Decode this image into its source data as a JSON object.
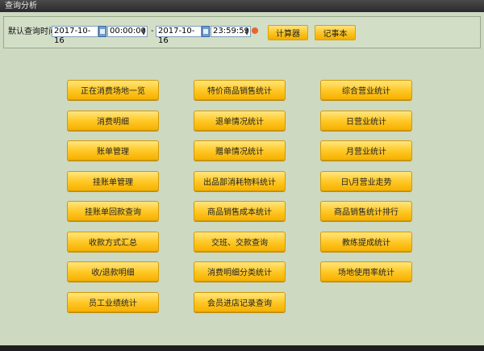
{
  "window": {
    "title": "查询分析"
  },
  "toolbar": {
    "label": "默认查询时间",
    "start_date": "2017-10-16",
    "start_time": "00:00:00",
    "separator": "-",
    "end_date": "2017-10-16",
    "end_time": "23:59:59",
    "calculator_label": "计算器",
    "notepad_label": "记事本"
  },
  "grid": [
    [
      "正在消费场地一览",
      "特价商品销售统计",
      "综合营业统计"
    ],
    [
      "消费明细",
      "退单情况统计",
      "日营业统计"
    ],
    [
      "账单管理",
      "赠单情况统计",
      "月营业统计"
    ],
    [
      "挂账单管理",
      "出品部消耗物料统计",
      "日\\月营业走势"
    ],
    [
      "挂账单回款查询",
      "商品销售成本统计",
      "商品销售统计排行"
    ],
    [
      "收款方式汇总",
      "交班、交款查询",
      "教练提成统计"
    ],
    [
      "收/退款明细",
      "消费明细分类统计",
      "场地使用率统计"
    ],
    [
      "员工业绩统计",
      "会员进店记录查询"
    ]
  ]
}
